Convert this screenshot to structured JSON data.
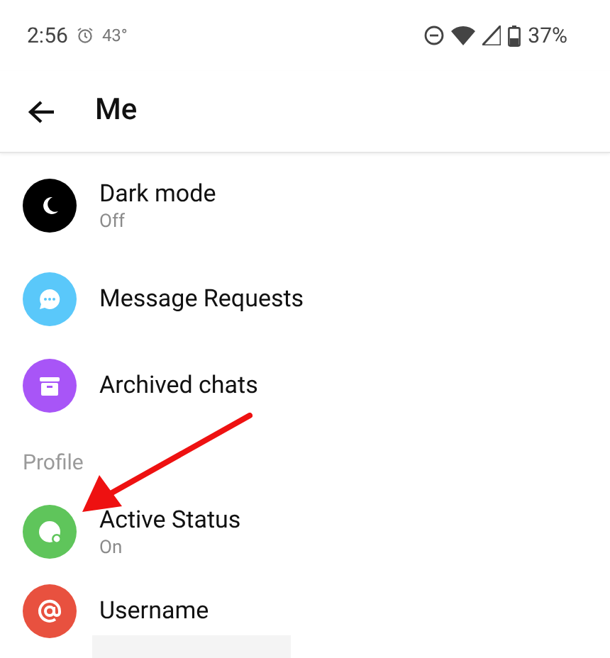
{
  "status_bar": {
    "time": "2:56",
    "temperature": "43°",
    "battery": "37%"
  },
  "header": {
    "title": "Me"
  },
  "items": [
    {
      "kind": "moon",
      "label": "Dark mode",
      "subtitle": "Off",
      "color": "#000000"
    },
    {
      "kind": "chat",
      "label": "Message Requests",
      "color": "#5ac8fa"
    },
    {
      "kind": "archive",
      "label": "Archived chats",
      "color": "#a855f7"
    }
  ],
  "sections": [
    {
      "title": "Profile",
      "items": [
        {
          "kind": "status",
          "label": "Active Status",
          "subtitle": "On",
          "color": "#5fc55b"
        },
        {
          "kind": "at",
          "label": "Username",
          "color": "#e8513f"
        }
      ]
    }
  ]
}
